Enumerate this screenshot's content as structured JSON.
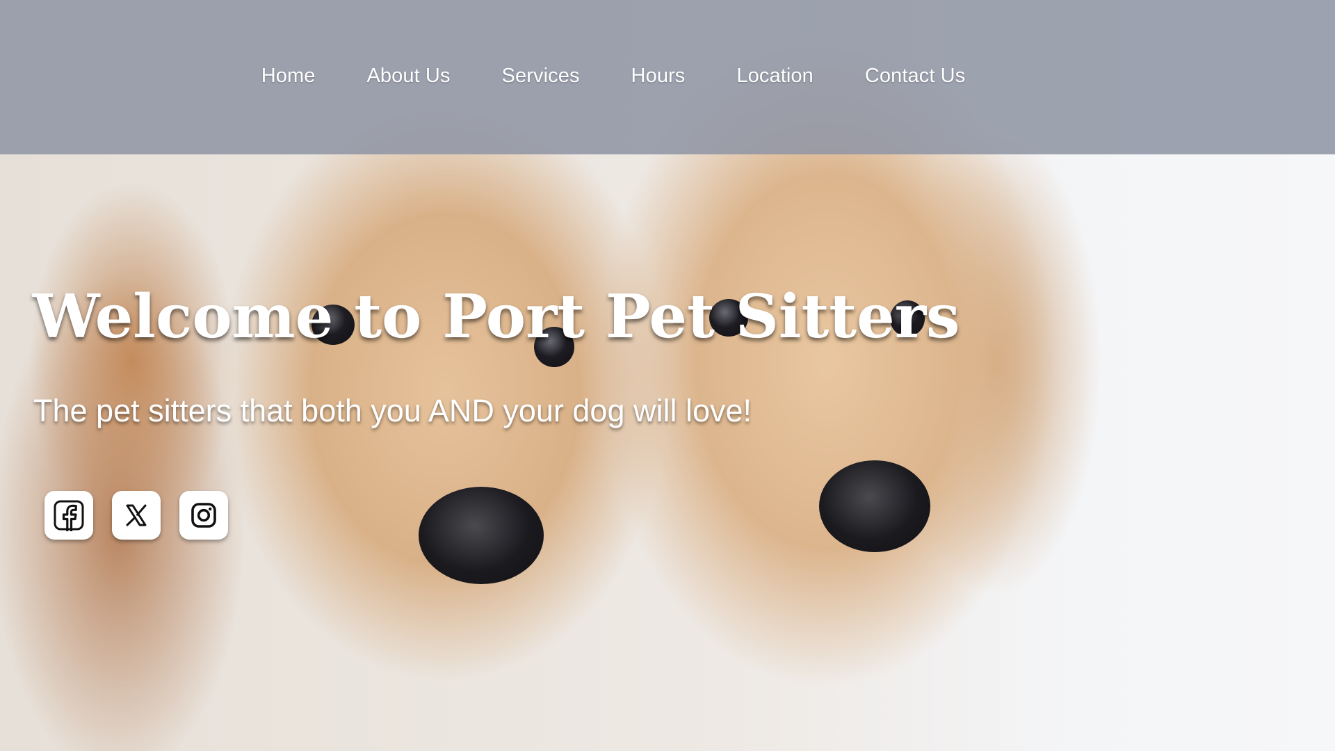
{
  "nav": {
    "items": [
      {
        "label": "Home"
      },
      {
        "label": "About Us"
      },
      {
        "label": "Services"
      },
      {
        "label": "Hours"
      },
      {
        "label": "Location"
      },
      {
        "label": "Contact Us"
      }
    ]
  },
  "hero": {
    "title": "Welcome to Port Pet Sitters",
    "subtitle": "The pet sitters that both you AND your dog will love!"
  },
  "social": {
    "icons": [
      "facebook-icon",
      "x-twitter-icon",
      "instagram-icon"
    ]
  },
  "colors": {
    "nav_bar": "#9196a5",
    "text": "#ffffff"
  }
}
